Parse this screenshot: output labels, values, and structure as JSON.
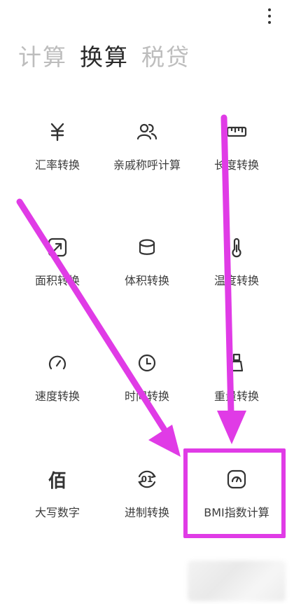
{
  "header": {
    "menu_icon": "more-vertical-icon"
  },
  "tabs": [
    {
      "label": "计算",
      "active": false
    },
    {
      "label": "换算",
      "active": true
    },
    {
      "label": "税贷",
      "active": false
    }
  ],
  "tools": [
    {
      "label": "汇率转换",
      "icon": "yuan-icon"
    },
    {
      "label": "亲戚称呼计算",
      "icon": "people-icon"
    },
    {
      "label": "长度转换",
      "icon": "ruler-icon"
    },
    {
      "label": "面积转换",
      "icon": "area-icon"
    },
    {
      "label": "体积转换",
      "icon": "volume-icon"
    },
    {
      "label": "温度转换",
      "icon": "thermometer-icon"
    },
    {
      "label": "速度转换",
      "icon": "speedometer-icon"
    },
    {
      "label": "时间转换",
      "icon": "clock-icon"
    },
    {
      "label": "重量转换",
      "icon": "weight-icon"
    },
    {
      "label": "大写数字",
      "icon": "bai-character-icon",
      "glyph": "佰"
    },
    {
      "label": "进制转换",
      "icon": "base-convert-icon",
      "glyph": "01"
    },
    {
      "label": "BMI指数计算",
      "icon": "bmi-gauge-icon"
    }
  ],
  "annotation": {
    "highlight_color": "#e03be6"
  }
}
